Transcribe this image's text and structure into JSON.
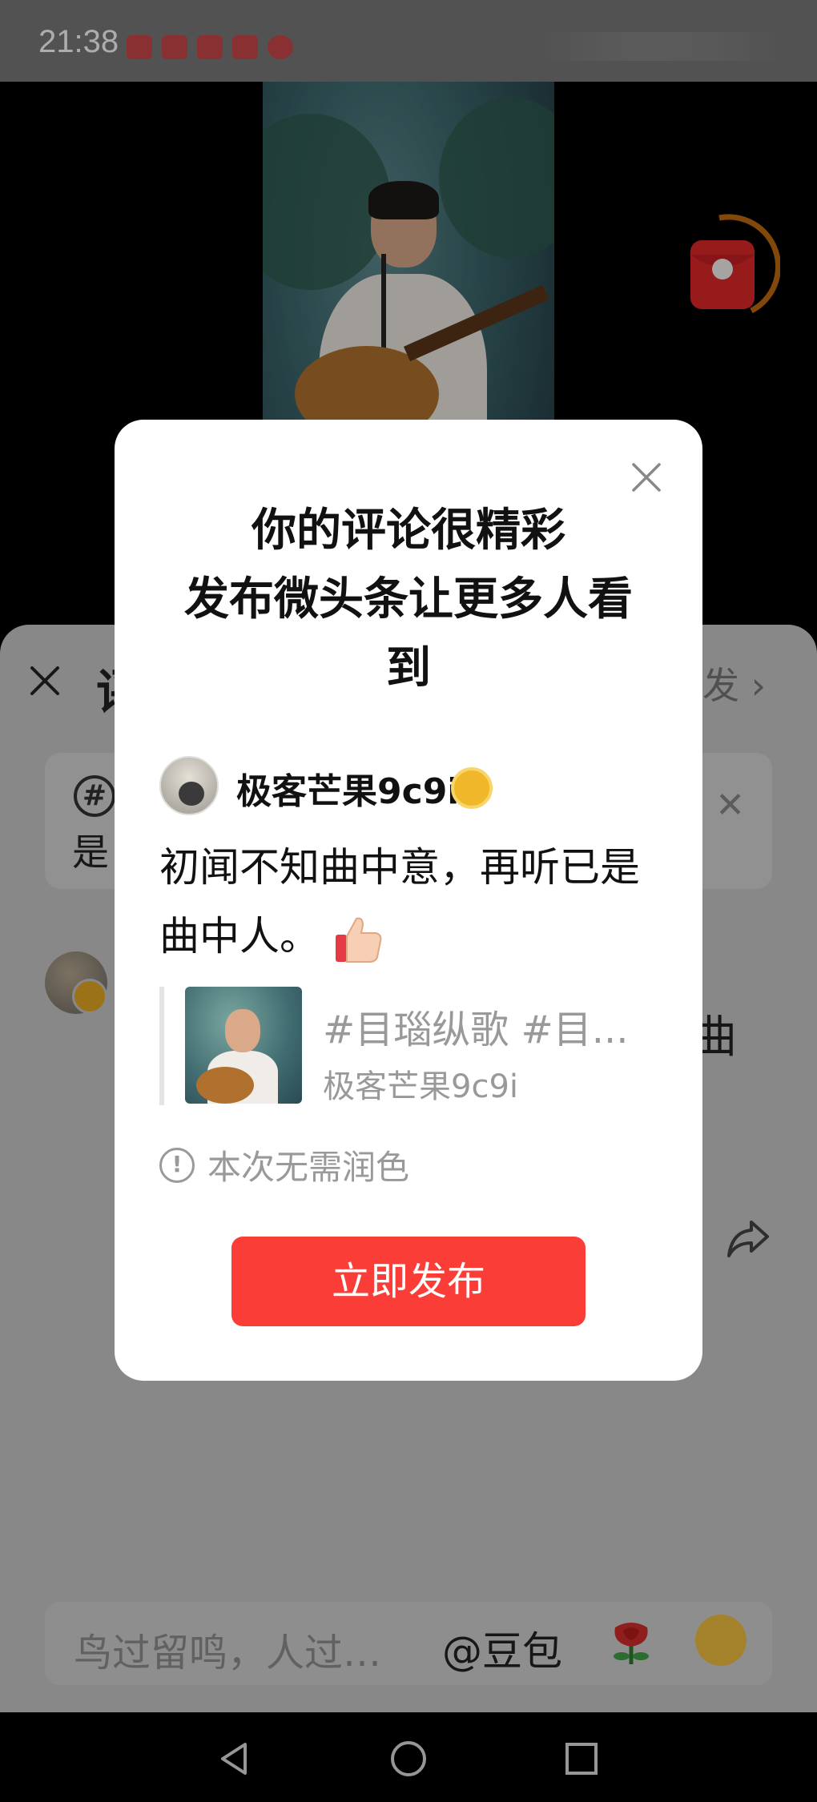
{
  "status_bar": {
    "time": "21:38"
  },
  "comment_sheet": {
    "title": "评",
    "post_label": "发",
    "topic_text": "是",
    "comment_text_tail": "曲"
  },
  "input_bar": {
    "placeholder": "鸟过留鸣，人过…",
    "doubao_label": "@豆包"
  },
  "modal": {
    "title_line1": "你的评论很精彩",
    "title_line2": "发布微头条让更多人看",
    "title_line3": "到",
    "username": "极客芒果9c9i",
    "content": "初闻不知曲中意，再听已是曲中人。",
    "quote_topic": "#目瑙纵歌 #目...",
    "quote_author": "极客芒果9c9i",
    "notice": "本次无需润色",
    "publish_label": "立即发布"
  },
  "colors": {
    "accent_red": "#fa3d36",
    "badge_gold": "#f0b72a"
  },
  "icons": [
    "close-icon",
    "topic-hash-icon",
    "badge-icon",
    "thumbs-up-icon",
    "info-icon",
    "share-icon",
    "rose-icon",
    "cry-emoji-icon",
    "back-icon",
    "home-icon",
    "recent-apps-icon",
    "red-packet-icon"
  ]
}
